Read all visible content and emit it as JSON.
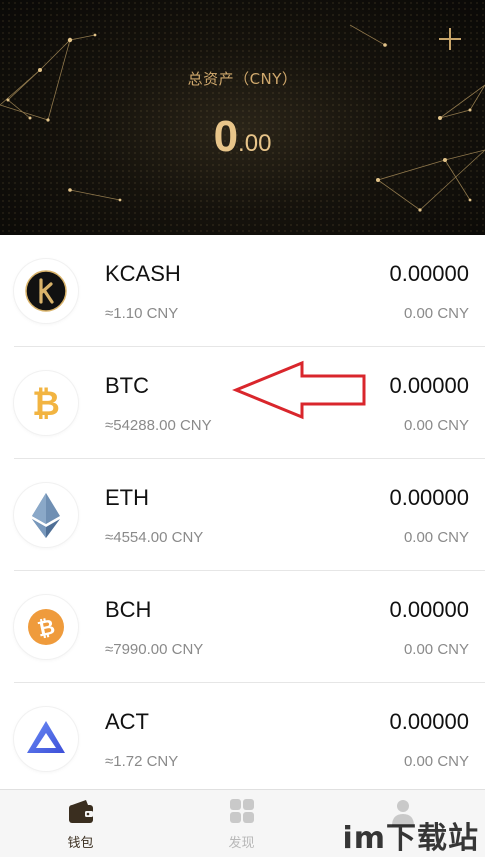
{
  "header": {
    "total_label": "总资产（CNY）",
    "amount_integer": "0",
    "amount_decimal": ".00"
  },
  "coins": [
    {
      "symbol": "KCASH",
      "price": "≈1.10 CNY",
      "balance": "0.00000",
      "value": "0.00 CNY",
      "icon": "kcash-icon",
      "color": "#d9b36a"
    },
    {
      "symbol": "BTC",
      "price": "≈54288.00 CNY",
      "balance": "0.00000",
      "value": "0.00 CNY",
      "icon": "bitcoin-icon",
      "color": "#f2b441"
    },
    {
      "symbol": "ETH",
      "price": "≈4554.00 CNY",
      "balance": "0.00000",
      "value": "0.00 CNY",
      "icon": "ethereum-icon",
      "color": "#5b7fa6"
    },
    {
      "symbol": "BCH",
      "price": "≈7990.00 CNY",
      "balance": "0.00000",
      "value": "0.00 CNY",
      "icon": "bitcoin-cash-icon",
      "color": "#ef9b3c"
    },
    {
      "symbol": "ACT",
      "price": "≈1.72 CNY",
      "balance": "0.00000",
      "value": "0.00 CNY",
      "icon": "achain-icon",
      "color": "#4b63e8"
    }
  ],
  "tabs": [
    {
      "label": "钱包",
      "icon": "wallet-icon",
      "active": true
    },
    {
      "label": "发现",
      "icon": "grid-icon",
      "active": false
    },
    {
      "label": "",
      "icon": "person-icon",
      "active": false
    }
  ],
  "watermark": "im下载站",
  "colors": {
    "accent_gold": "#e8c58a",
    "arrow_red": "#d9262c"
  }
}
